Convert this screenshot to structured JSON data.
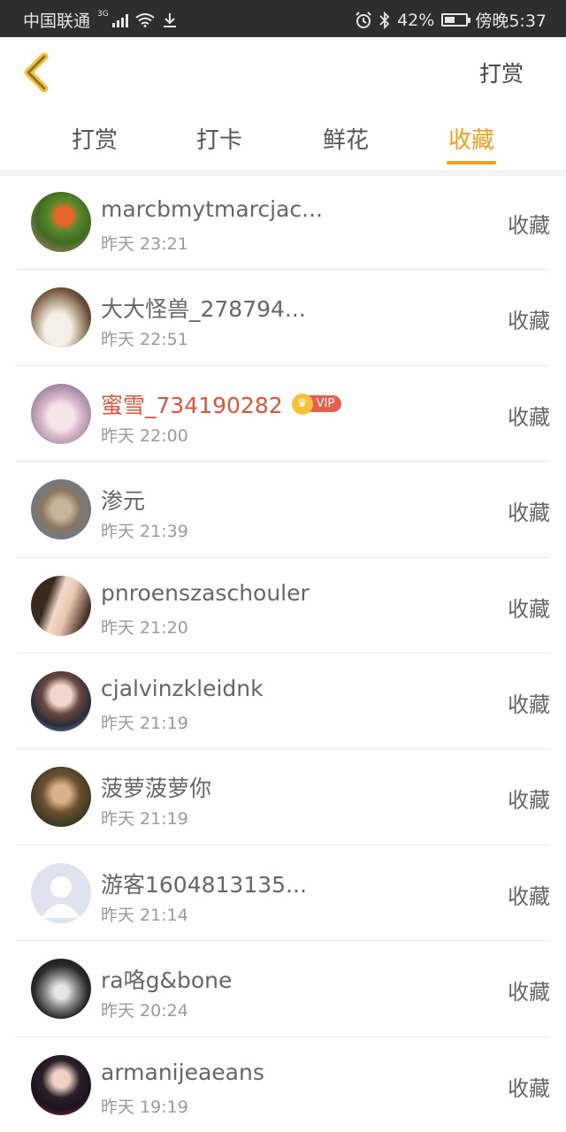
{
  "status_bar": {
    "carrier": "中国联通",
    "network": "3G",
    "battery": "42%",
    "time": "傍晚5:37",
    "battery_level": 0.42
  },
  "header": {
    "back_icon": "chevron-left-icon",
    "title": "打赏"
  },
  "tabs": [
    {
      "label": "打赏",
      "active": false
    },
    {
      "label": "打卡",
      "active": false
    },
    {
      "label": "鲜花",
      "active": false
    },
    {
      "label": "收藏",
      "active": true
    }
  ],
  "accent_color": "#f0a01a",
  "vip_color": "#d9553b",
  "items": [
    {
      "name": "marcbmytmarcjac...",
      "time": "昨天 23:21",
      "action": "收藏",
      "vip": false,
      "vip_label": ""
    },
    {
      "name": "大大怪兽_278794...",
      "time": "昨天 22:51",
      "action": "收藏",
      "vip": false,
      "vip_label": ""
    },
    {
      "name": "蜜雪_734190282",
      "time": "昨天 22:00",
      "action": "收藏",
      "vip": true,
      "vip_label": "VIP"
    },
    {
      "name": "渗元",
      "time": "昨天 21:39",
      "action": "收藏",
      "vip": false,
      "vip_label": ""
    },
    {
      "name": "pnroenszaschouler",
      "time": "昨天 21:20",
      "action": "收藏",
      "vip": false,
      "vip_label": ""
    },
    {
      "name": "cjalvinzkleidnk",
      "time": "昨天 21:19",
      "action": "收藏",
      "vip": false,
      "vip_label": ""
    },
    {
      "name": "菠萝菠萝你",
      "time": "昨天 21:19",
      "action": "收藏",
      "vip": false,
      "vip_label": ""
    },
    {
      "name": "游客1604813135...",
      "time": "昨天 21:14",
      "action": "收藏",
      "vip": false,
      "vip_label": ""
    },
    {
      "name": "ra咯g&bone",
      "time": "昨天 20:24",
      "action": "收藏",
      "vip": false,
      "vip_label": ""
    },
    {
      "name": "armanijeaeans",
      "time": "昨天 19:19",
      "action": "收藏",
      "vip": false,
      "vip_label": ""
    }
  ]
}
